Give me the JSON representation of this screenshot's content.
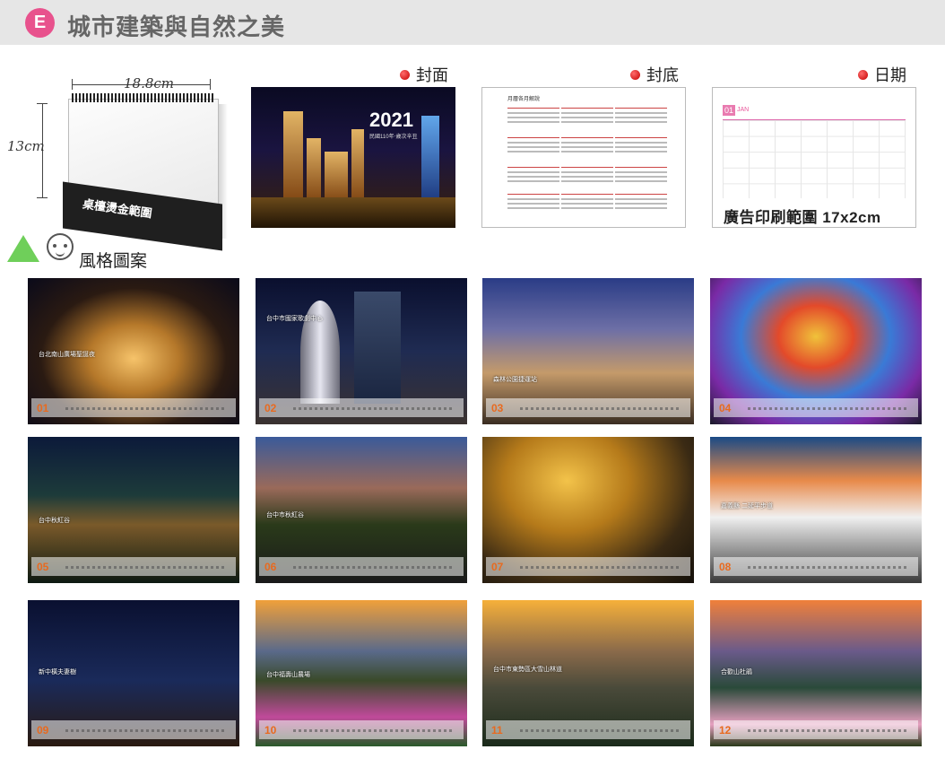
{
  "header": {
    "badge": "E",
    "title": "城市建築與自然之美"
  },
  "product": {
    "width_label": "18.8cm",
    "height_label": "13cm",
    "base_label": "桌檯燙金範圍"
  },
  "style_label": "風格圖案",
  "sections": {
    "cover": "封面",
    "back": "封底",
    "date": "日期"
  },
  "cover": {
    "year": "2021",
    "subtitle": "民國110年‧歲次辛丑"
  },
  "back": {
    "title": "月曆各月解說"
  },
  "date_page": {
    "month_num": "01",
    "month_name": "JAN",
    "ad_range": "廣告印刷範圍 17x2cm"
  },
  "months": [
    {
      "num": "01",
      "caption": "台北南山廣場聖誕夜"
    },
    {
      "num": "02",
      "caption": "台中市國家歌劇中心"
    },
    {
      "num": "03",
      "caption": "森林公園捷運站"
    },
    {
      "num": "04",
      "caption": ""
    },
    {
      "num": "05",
      "caption": "台中秋紅谷"
    },
    {
      "num": "06",
      "caption": "台中市秋紅谷"
    },
    {
      "num": "07",
      "caption": ""
    },
    {
      "num": "08",
      "caption": "嘉義縣 二延平步道"
    },
    {
      "num": "09",
      "caption": "新中橫夫妻樹"
    },
    {
      "num": "10",
      "caption": "台中福壽山農場"
    },
    {
      "num": "11",
      "caption": "台中市東勢區大雪山林道"
    },
    {
      "num": "12",
      "caption": "合歡山杜鵑"
    }
  ]
}
